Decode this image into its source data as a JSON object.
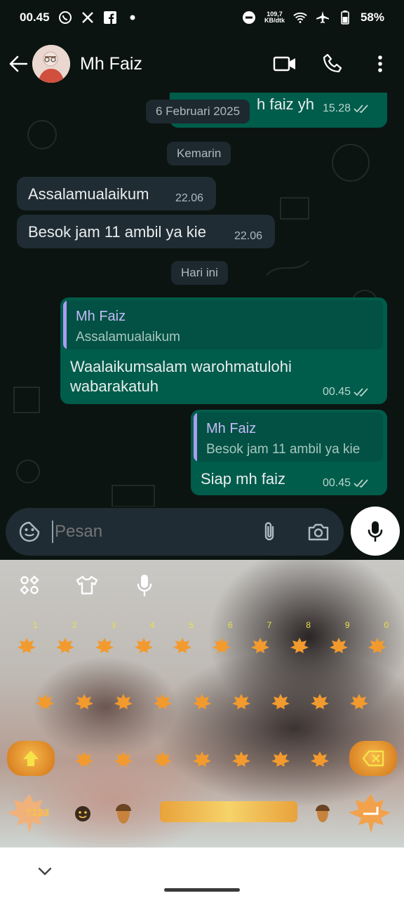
{
  "status_bar": {
    "time": "00.45",
    "net_speed_value": "109,7",
    "net_speed_unit": "KB/dtk",
    "battery": "58%"
  },
  "header": {
    "contact_name": "Mh Faiz"
  },
  "chat": {
    "messages": [
      {
        "type": "out",
        "text": "h faiz yh",
        "time": "15.28"
      },
      {
        "type": "date",
        "text": "6 Februari 2025"
      },
      {
        "type": "date",
        "text": "Kemarin"
      },
      {
        "type": "in",
        "text": "Assalamualaikum",
        "time": "22.06"
      },
      {
        "type": "in",
        "text": "Besok jam 11 ambil ya kie",
        "time": "22.06"
      },
      {
        "type": "date",
        "text": "Hari ini"
      },
      {
        "type": "out",
        "quote_name": "Mh Faiz",
        "quote_text": "Assalamualaikum",
        "text_line1": "Waalaikumsalam warohmatulohi",
        "text_line2": "wabarakatuh",
        "time": "00.45"
      },
      {
        "type": "out",
        "quote_name": "Mh Faiz",
        "quote_text": "Besok jam 11 ambil ya kie",
        "text": "Siap mh faiz",
        "time": "00.45"
      }
    ]
  },
  "input": {
    "placeholder": "Pesan"
  },
  "keyboard": {
    "symbols_label": "?123",
    "row1_hints": [
      "1",
      "2",
      "3",
      "4",
      "5",
      "6",
      "7",
      "8",
      "9",
      "0"
    ],
    "theme_colors": {
      "key": "#f29a2e",
      "hint": "#e9e04a"
    }
  },
  "colors": {
    "outgoing_bubble": "#005c4b",
    "incoming_bubble": "#202c33",
    "quote_accent": "#a99cf2",
    "background": "#0b1410"
  }
}
